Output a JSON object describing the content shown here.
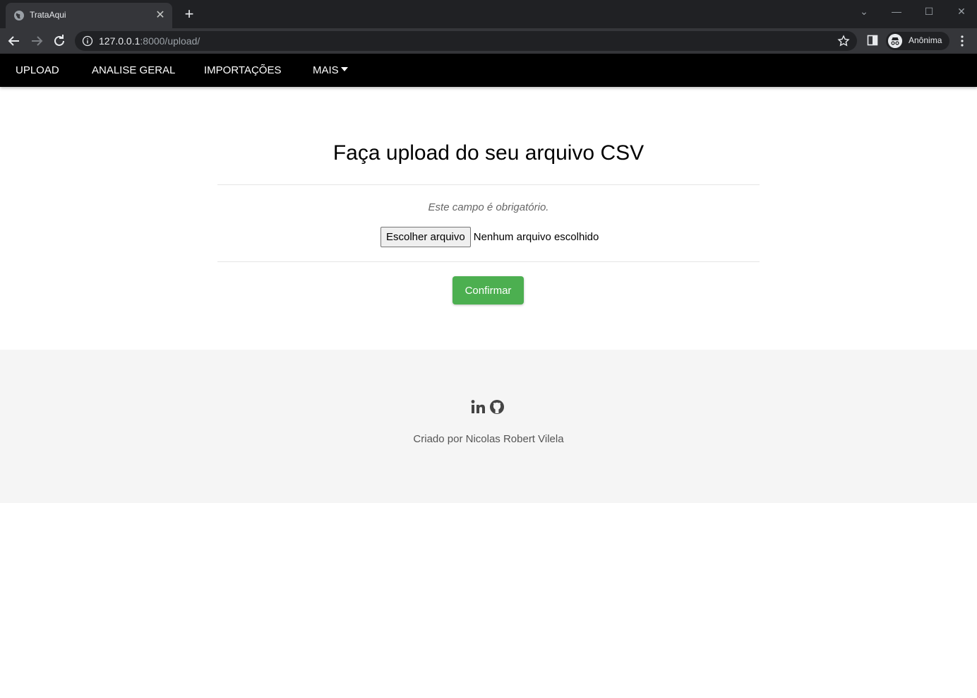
{
  "browser": {
    "tab_title": "TrataAqui",
    "url_host": "127.0.0.1",
    "url_rest": ":8000/upload/",
    "profile_label": "Anônima"
  },
  "nav": {
    "items": [
      "UPLOAD",
      "ANALISE GERAL",
      "IMPORTAÇÕES",
      "MAIS"
    ]
  },
  "upload": {
    "title": "Faça upload do seu arquivo CSV",
    "required_hint": "Este campo é obrigatório.",
    "choose_button": "Escolher arquivo",
    "no_file_text": "Nenhum arquivo escolhido",
    "confirm_button": "Confirmar",
    "confirm_color": "#4caf50"
  },
  "footer": {
    "icons": [
      "linkedin-icon",
      "github-icon"
    ],
    "credit": "Criado por Nicolas Robert Vilela"
  }
}
